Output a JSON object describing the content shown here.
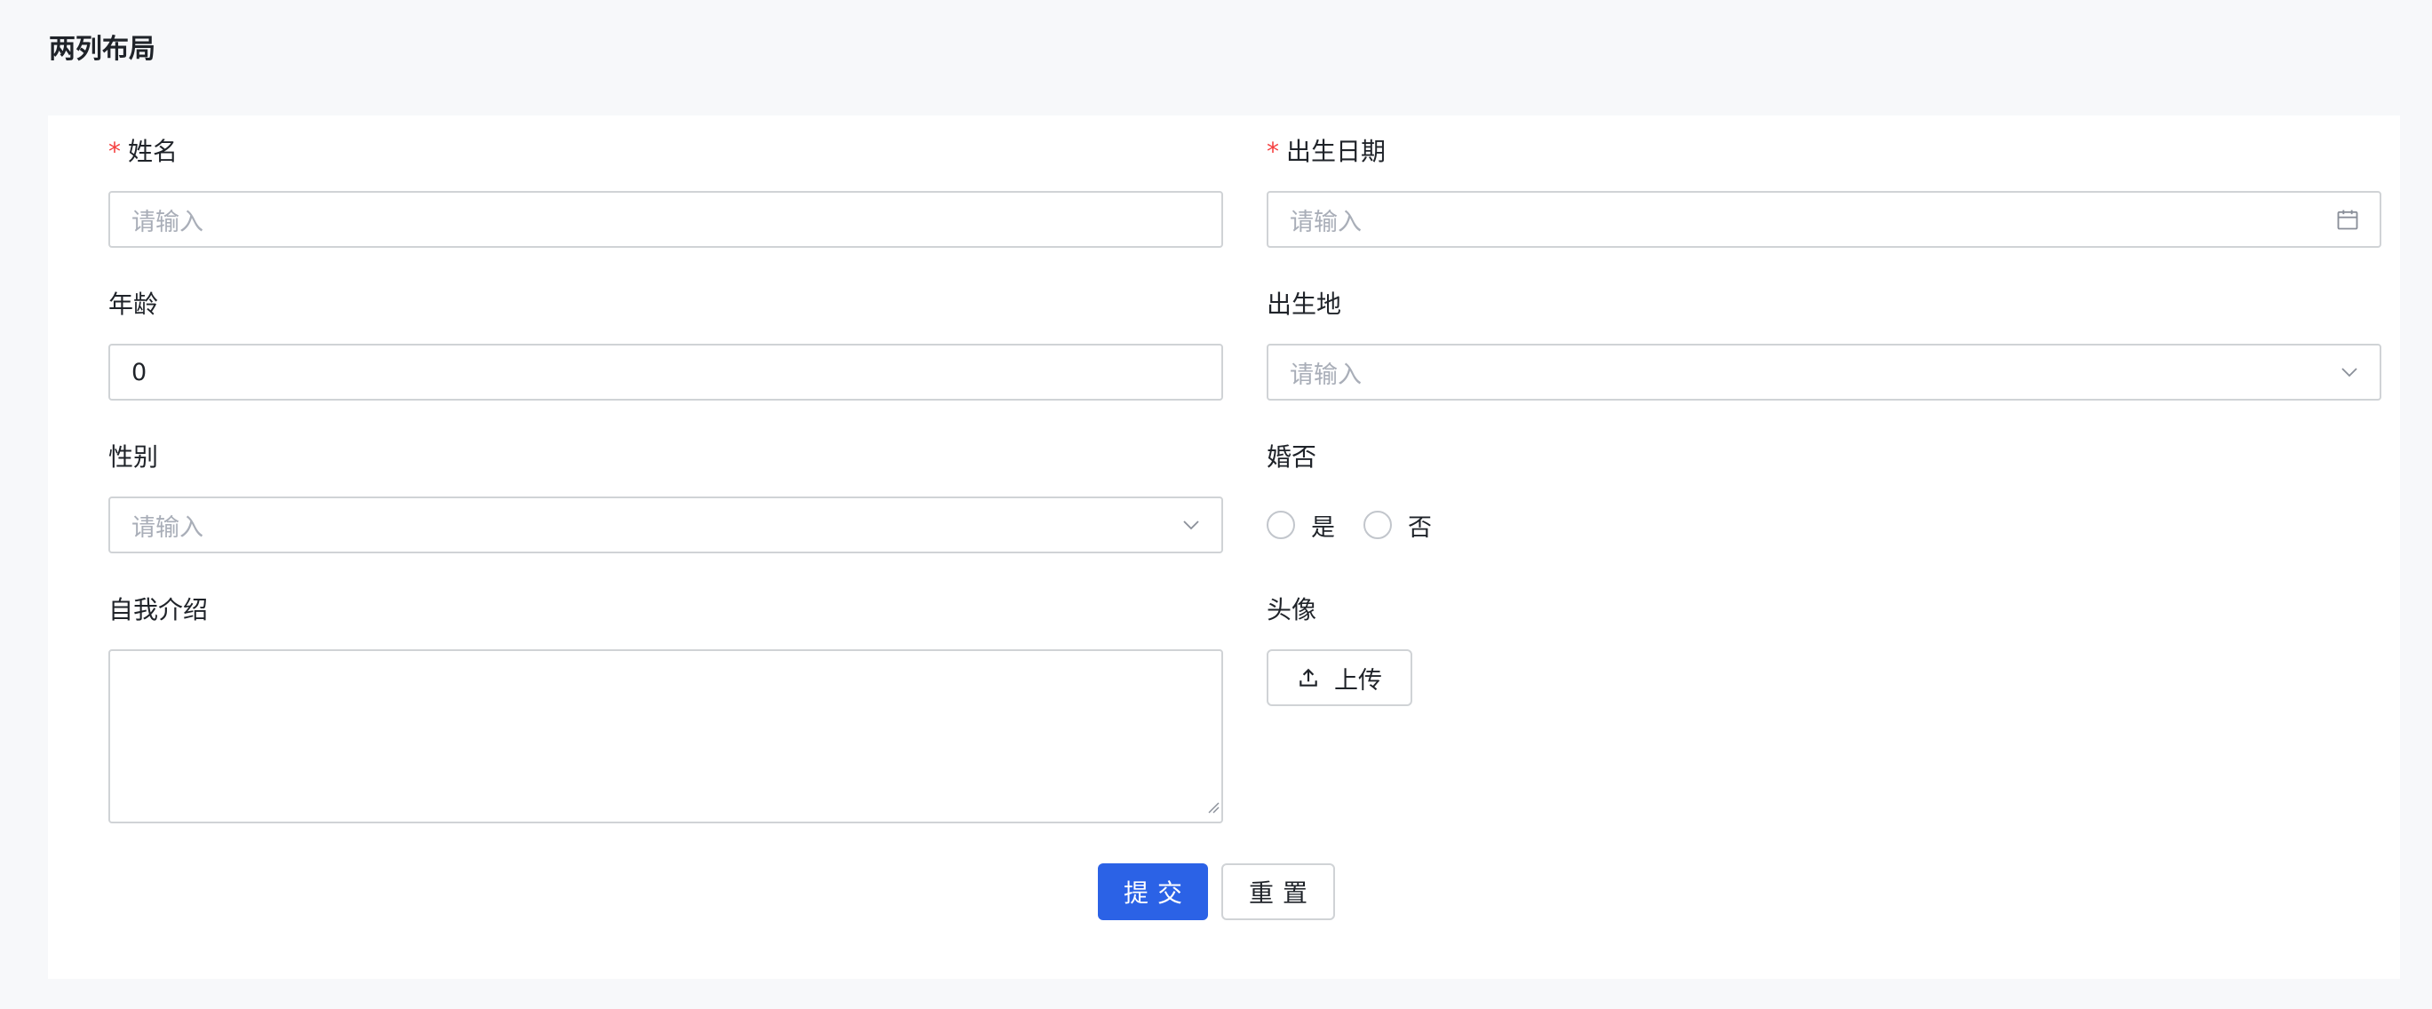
{
  "page": {
    "title": "两列布局"
  },
  "form": {
    "name": {
      "label": "姓名",
      "required": true,
      "placeholder": "请输入"
    },
    "birthdate": {
      "label": "出生日期",
      "required": true,
      "placeholder": "请输入"
    },
    "age": {
      "label": "年龄",
      "value": "0"
    },
    "birthplace": {
      "label": "出生地",
      "placeholder": "请输入"
    },
    "gender": {
      "label": "性别",
      "placeholder": "请输入"
    },
    "married": {
      "label": "婚否",
      "options": [
        "是",
        "否"
      ]
    },
    "intro": {
      "label": "自我介绍",
      "value": ""
    },
    "avatar": {
      "label": "头像",
      "upload_label": "上传"
    }
  },
  "actions": {
    "submit": "提交",
    "reset": "重置"
  },
  "colors": {
    "primary": "#2b62e6",
    "required": "#f53f3f",
    "border": "#d0d3d6",
    "placeholder": "#a9aeb8"
  },
  "icons": {
    "birthdate": "calendar-icon",
    "birthplace": "chevron-down-icon",
    "gender": "chevron-down-icon",
    "upload": "upload-icon"
  }
}
